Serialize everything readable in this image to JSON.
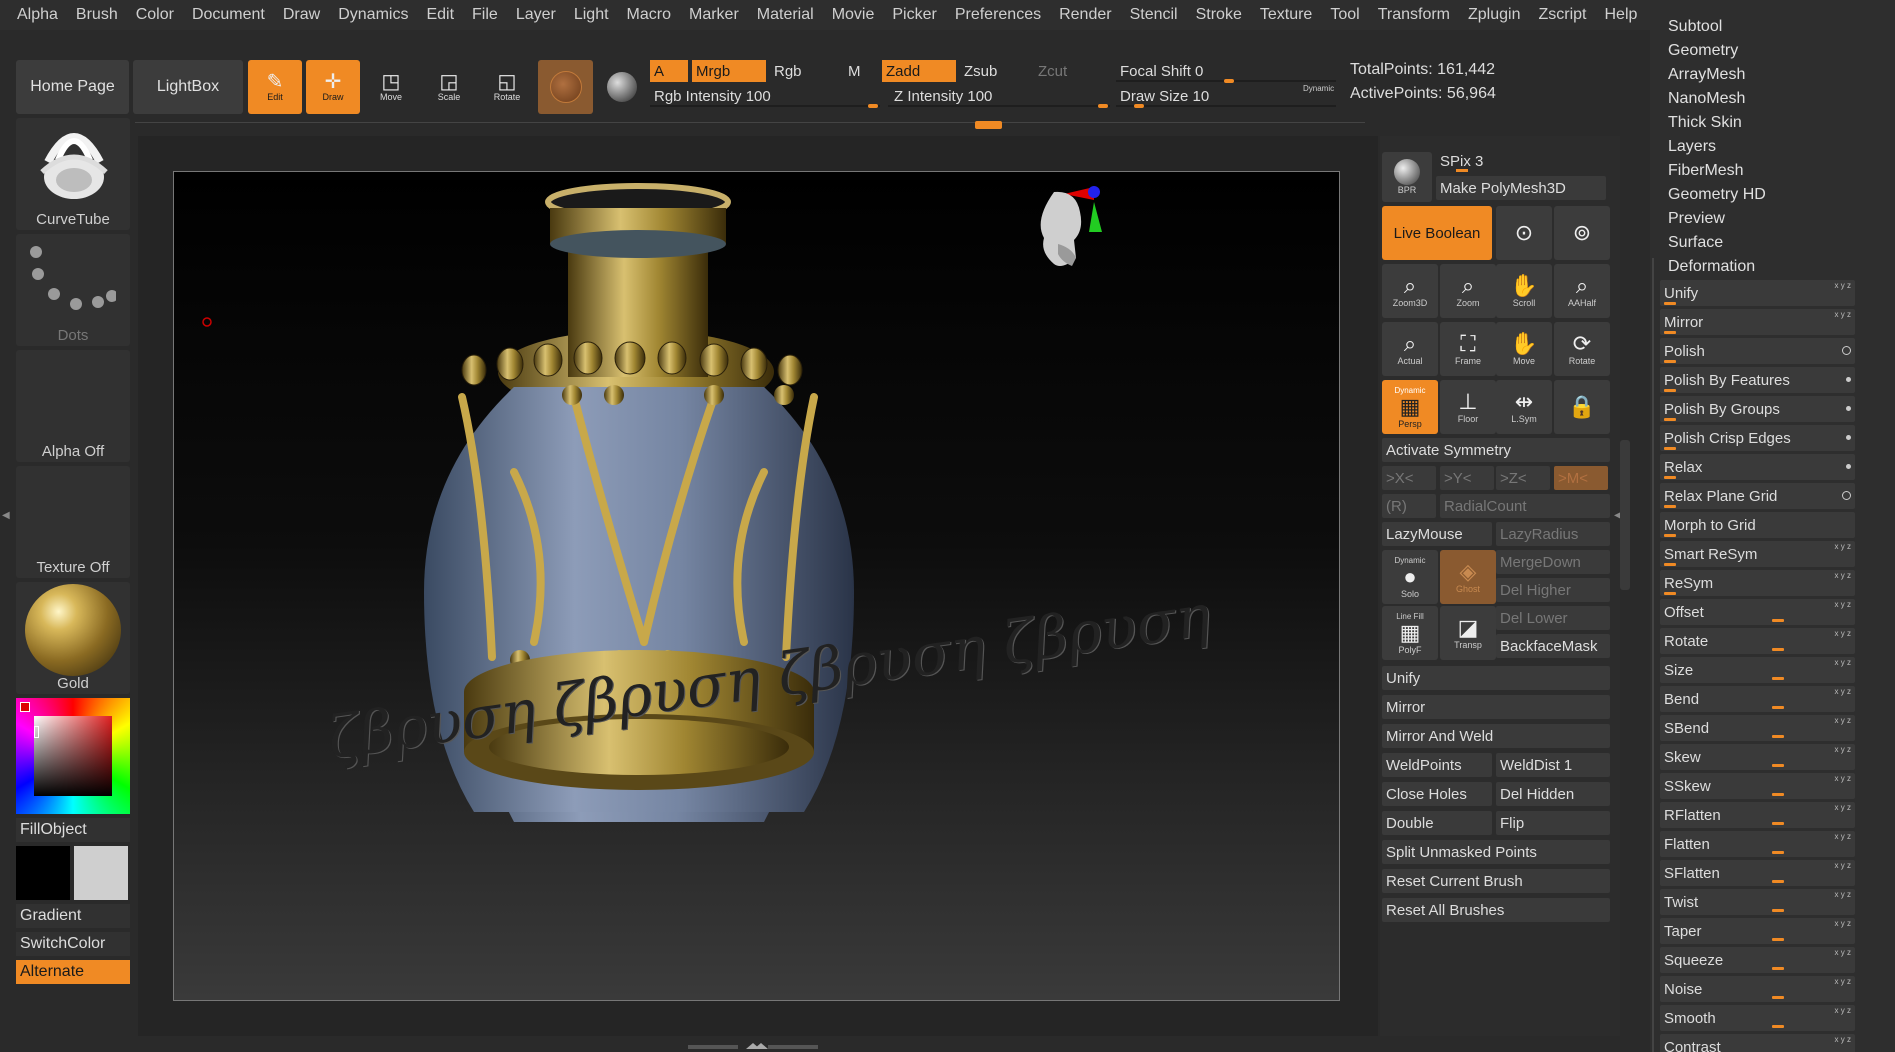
{
  "menu": [
    "Alpha",
    "Brush",
    "Color",
    "Document",
    "Draw",
    "Dynamics",
    "Edit",
    "File",
    "Layer",
    "Light",
    "Macro",
    "Marker",
    "Material",
    "Movie",
    "Picker",
    "Preferences",
    "Render",
    "Stencil",
    "Stroke",
    "Texture",
    "Tool",
    "Transform",
    "Zplugin",
    "Zscript",
    "Help"
  ],
  "top": {
    "home": "Home Page",
    "lightbox": "LightBox",
    "edit": "Edit",
    "draw": "Draw",
    "move": "Move",
    "scale": "Scale",
    "rotate": "Rotate",
    "a": "A",
    "mrgb": "Mrgb",
    "rgb": "Rgb",
    "m": "M",
    "zadd": "Zadd",
    "zsub": "Zsub",
    "zcut": "Zcut",
    "rgb_intensity": "Rgb Intensity 100",
    "z_intensity": "Z Intensity 100",
    "focal_shift": "Focal Shift 0",
    "draw_size": "Draw Size 10",
    "dynamic": "Dynamic",
    "total_points": "TotalPoints: 161,442",
    "active_points": "ActivePoints: 56,964"
  },
  "left": {
    "brush": "CurveTube",
    "stroke": "Dots",
    "alpha": "Alpha Off",
    "texture": "Texture Off",
    "material": "Gold",
    "fill": "FillObject",
    "gradient": "Gradient",
    "switch": "SwitchColor",
    "alternate": "Alternate"
  },
  "canvas": {
    "text": "ζβρυση ζβρυση ζβρυση ζβρυση"
  },
  "toolpanel": {
    "spix": "SPix 3",
    "make_polymesh": "Make PolyMesh3D",
    "bpr": "BPR",
    "live_boolean": "Live Boolean",
    "icons1": [
      "Zoom3D",
      "Zoom",
      "Scroll",
      "AAHalf"
    ],
    "icons2": [
      "Actual",
      "Frame",
      "Move",
      "Rotate"
    ],
    "persp": "Persp",
    "persp_top": "Dynamic",
    "floor": "Floor",
    "lsym": "L.Sym",
    "activate_symmetry": "Activate Symmetry",
    "x": ">X<",
    "y": ">Y<",
    "z": ">Z<",
    "m": ">M<",
    "r": "(R)",
    "radial": "RadialCount",
    "lazymouse": "LazyMouse",
    "lazyradius": "LazyRadius",
    "solo_top": "Dynamic",
    "solo": "Solo",
    "ghost": "Ghost",
    "linefill_top": "Line Fill",
    "polyf": "PolyF",
    "transp": "Transp",
    "mergedown": "MergeDown",
    "delhigher": "Del Higher",
    "dellower": "Del Lower",
    "backface": "BackfaceMask",
    "unify": "Unify",
    "mirror": "Mirror",
    "mirror_weld": "Mirror And Weld",
    "weldpoints": "WeldPoints",
    "welddist": "WeldDist 1",
    "close_holes": "Close Holes",
    "del_hidden": "Del Hidden",
    "double": "Double",
    "flip": "Flip",
    "split_unmasked": "Split Unmasked Points",
    "reset_current": "Reset Current Brush",
    "reset_all": "Reset All Brushes"
  },
  "subpanel": [
    "Subtool",
    "Geometry",
    "ArrayMesh",
    "NanoMesh",
    "Thick Skin",
    "Layers",
    "FiberMesh",
    "Geometry HD",
    "Preview",
    "Surface",
    "Deformation"
  ],
  "deformation": {
    "rows": [
      {
        "label": "Unify",
        "type": "marks"
      },
      {
        "label": "Mirror",
        "type": "marks"
      },
      {
        "label": "Polish",
        "type": "circle"
      },
      {
        "label": "Polish By Features",
        "type": "dot"
      },
      {
        "label": "Polish By Groups",
        "type": "dot"
      },
      {
        "label": "Polish Crisp Edges",
        "type": "dot"
      },
      {
        "label": "Relax",
        "type": "dot"
      },
      {
        "label": "Relax Plane Grid",
        "type": "circle"
      },
      {
        "label": "Morph to Grid",
        "type": "plain"
      },
      {
        "label": "Smart ReSym",
        "type": "marks"
      },
      {
        "label": "ReSym",
        "type": "marks"
      },
      {
        "label": "Offset",
        "type": "slider"
      },
      {
        "label": "Rotate",
        "type": "slider"
      },
      {
        "label": "Size",
        "type": "slider"
      },
      {
        "label": "Bend",
        "type": "slider"
      },
      {
        "label": "SBend",
        "type": "slider"
      },
      {
        "label": "Skew",
        "type": "slider"
      },
      {
        "label": "SSkew",
        "type": "slider"
      },
      {
        "label": "RFlatten",
        "type": "slider"
      },
      {
        "label": "Flatten",
        "type": "slider"
      },
      {
        "label": "SFlatten",
        "type": "slider"
      },
      {
        "label": "Twist",
        "type": "slider"
      },
      {
        "label": "Taper",
        "type": "slider"
      },
      {
        "label": "Squeeze",
        "type": "slider"
      },
      {
        "label": "Noise",
        "type": "slider"
      },
      {
        "label": "Smooth",
        "type": "slider"
      },
      {
        "label": "Contrast",
        "type": "slider"
      }
    ],
    "marks": "x y z"
  }
}
